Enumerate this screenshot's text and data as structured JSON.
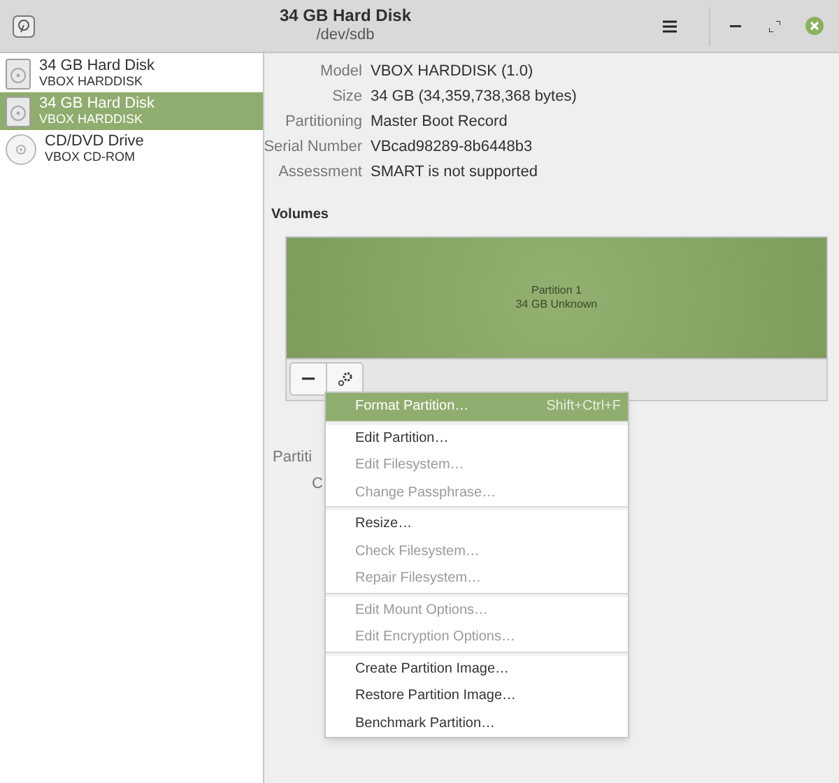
{
  "window": {
    "title": "34 GB Hard Disk",
    "subtitle": "/dev/sdb"
  },
  "sidebar": {
    "items": [
      {
        "kind": "disk",
        "title": "34 GB Hard Disk",
        "subtitle": "VBOX HARDDISK",
        "selected": false
      },
      {
        "kind": "disk",
        "title": "34 GB Hard Disk",
        "subtitle": "VBOX HARDDISK",
        "selected": true
      },
      {
        "kind": "optical",
        "title": "CD/DVD Drive",
        "subtitle": "VBOX CD-ROM",
        "selected": false
      }
    ]
  },
  "details": [
    {
      "label": "Model",
      "value": "VBOX HARDDISK (1.0)"
    },
    {
      "label": "Size",
      "value": "34 GB (34,359,738,368 bytes)"
    },
    {
      "label": "Partitioning",
      "value": "Master Boot Record"
    },
    {
      "label": "Serial Number",
      "value": "VBcad98289-8b6448b3"
    },
    {
      "label": "Assessment",
      "value": "SMART is not supported"
    }
  ],
  "volumes": {
    "heading": "Volumes",
    "partition": {
      "name": "Partition 1",
      "info": "34 GB Unknown"
    }
  },
  "hidden_labels": [
    "Partiti",
    "C"
  ],
  "menu": [
    {
      "kind": "item",
      "label": "Format Partition…",
      "shortcut": "Shift+Ctrl+F",
      "selected": true,
      "disabled": false
    },
    {
      "kind": "separator"
    },
    {
      "kind": "item",
      "label": "Edit Partition…",
      "selected": false,
      "disabled": false
    },
    {
      "kind": "item",
      "label": "Edit Filesystem…",
      "selected": false,
      "disabled": true
    },
    {
      "kind": "item",
      "label": "Change Passphrase…",
      "selected": false,
      "disabled": true
    },
    {
      "kind": "separator"
    },
    {
      "kind": "item",
      "label": "Resize…",
      "selected": false,
      "disabled": false
    },
    {
      "kind": "item",
      "label": "Check Filesystem…",
      "selected": false,
      "disabled": true
    },
    {
      "kind": "item",
      "label": "Repair Filesystem…",
      "selected": false,
      "disabled": true
    },
    {
      "kind": "separator"
    },
    {
      "kind": "item",
      "label": "Edit Mount Options…",
      "selected": false,
      "disabled": true
    },
    {
      "kind": "item",
      "label": "Edit Encryption Options…",
      "selected": false,
      "disabled": true
    },
    {
      "kind": "separator"
    },
    {
      "kind": "item",
      "label": "Create Partition Image…",
      "selected": false,
      "disabled": false
    },
    {
      "kind": "item",
      "label": "Restore Partition Image…",
      "selected": false,
      "disabled": false
    },
    {
      "kind": "item",
      "label": "Benchmark Partition…",
      "selected": false,
      "disabled": false
    }
  ]
}
